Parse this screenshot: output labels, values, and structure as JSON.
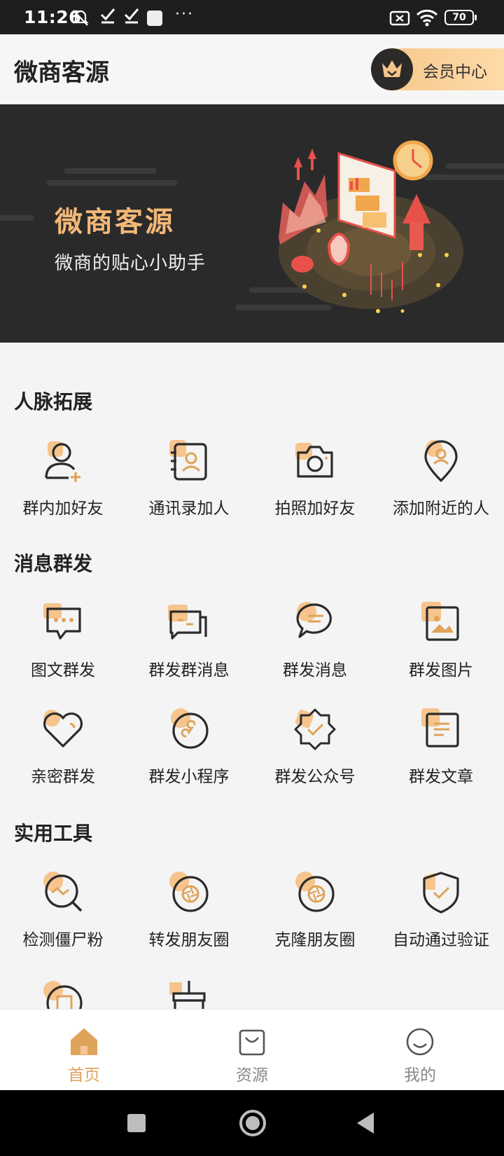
{
  "status_bar": {
    "time": "11:26",
    "battery": "70",
    "dots": "···"
  },
  "header": {
    "title": "微商客源",
    "vip_label": "会员中心"
  },
  "banner": {
    "title": "微商客源",
    "subtitle": "微商的贴心小助手"
  },
  "sections": [
    {
      "title": "人脉拓展",
      "items": [
        {
          "label": "群内加好友",
          "icon": "add-user-icon"
        },
        {
          "label": "通讯录加人",
          "icon": "contacts-book-icon"
        },
        {
          "label": "拍照加好友",
          "icon": "camera-icon"
        },
        {
          "label": "添加附近的人",
          "icon": "location-pin-icon"
        }
      ]
    },
    {
      "title": "消息群发",
      "items": [
        {
          "label": "图文群发",
          "icon": "chat-bubble-icon"
        },
        {
          "label": "群发群消息",
          "icon": "group-message-icon"
        },
        {
          "label": "群发消息",
          "icon": "message-icon"
        },
        {
          "label": "群发图片",
          "icon": "image-icon"
        },
        {
          "label": "亲密群发",
          "icon": "heart-icon"
        },
        {
          "label": "群发小程序",
          "icon": "mini-program-icon"
        },
        {
          "label": "群发公众号",
          "icon": "badge-check-icon"
        },
        {
          "label": "群发文章",
          "icon": "article-icon"
        }
      ]
    },
    {
      "title": "实用工具",
      "items": [
        {
          "label": "检测僵尸粉",
          "icon": "detect-search-icon"
        },
        {
          "label": "转发朋友圈",
          "icon": "moments-icon"
        },
        {
          "label": "克隆朋友圈",
          "icon": "moments-clone-icon"
        },
        {
          "label": "自动通过验证",
          "icon": "shield-check-icon"
        }
      ]
    }
  ],
  "tabbar": {
    "items": [
      {
        "label": "首页",
        "icon": "home-icon",
        "active": true
      },
      {
        "label": "资源",
        "icon": "bag-icon",
        "active": false
      },
      {
        "label": "我的",
        "icon": "smile-icon",
        "active": false
      }
    ]
  },
  "colors": {
    "accent": "#e0a35a",
    "icon_stroke": "#2b2b2b",
    "icon_bg": "#f6c48c"
  }
}
